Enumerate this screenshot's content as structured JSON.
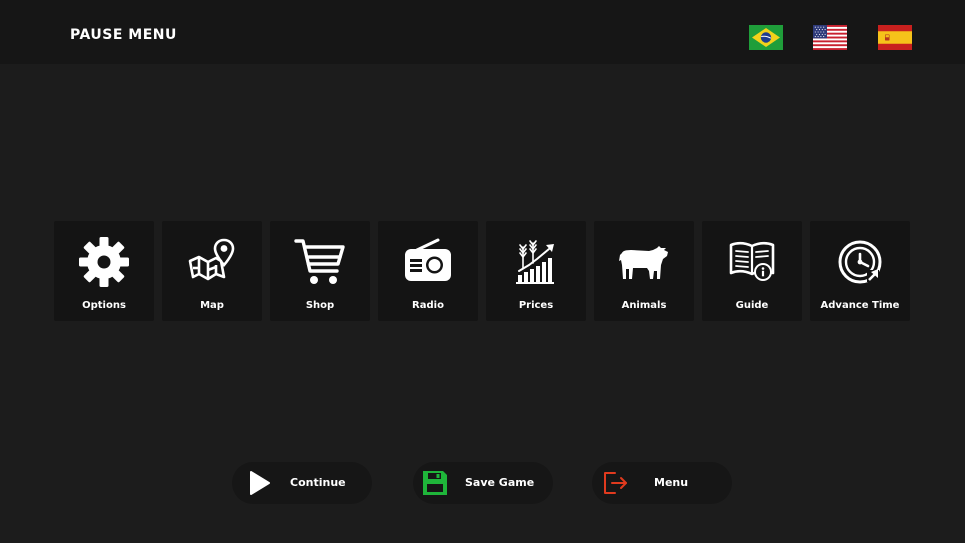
{
  "header": {
    "title": "PAUSE MENU",
    "languages": [
      {
        "name": "flag-brazil-icon"
      },
      {
        "name": "flag-usa-icon"
      },
      {
        "name": "flag-spain-icon"
      }
    ]
  },
  "menu": {
    "tiles": [
      {
        "label": "Options",
        "icon": "gear-icon"
      },
      {
        "label": "Map",
        "icon": "map-pin-icon"
      },
      {
        "label": "Shop",
        "icon": "shopping-cart-icon"
      },
      {
        "label": "Radio",
        "icon": "radio-icon"
      },
      {
        "label": "Prices",
        "icon": "crop-price-chart-icon"
      },
      {
        "label": "Animals",
        "icon": "cow-icon"
      },
      {
        "label": "Guide",
        "icon": "guide-book-icon"
      },
      {
        "label": "Advance Time",
        "icon": "clock-forward-icon"
      }
    ]
  },
  "actions": {
    "continue_label": "Continue",
    "save_label": "Save Game",
    "menu_label": "Menu"
  },
  "colors": {
    "background": "#1c1c1c",
    "tile": "#141414",
    "save_accent": "#1fb53a",
    "exit_accent": "#e03a1e"
  }
}
